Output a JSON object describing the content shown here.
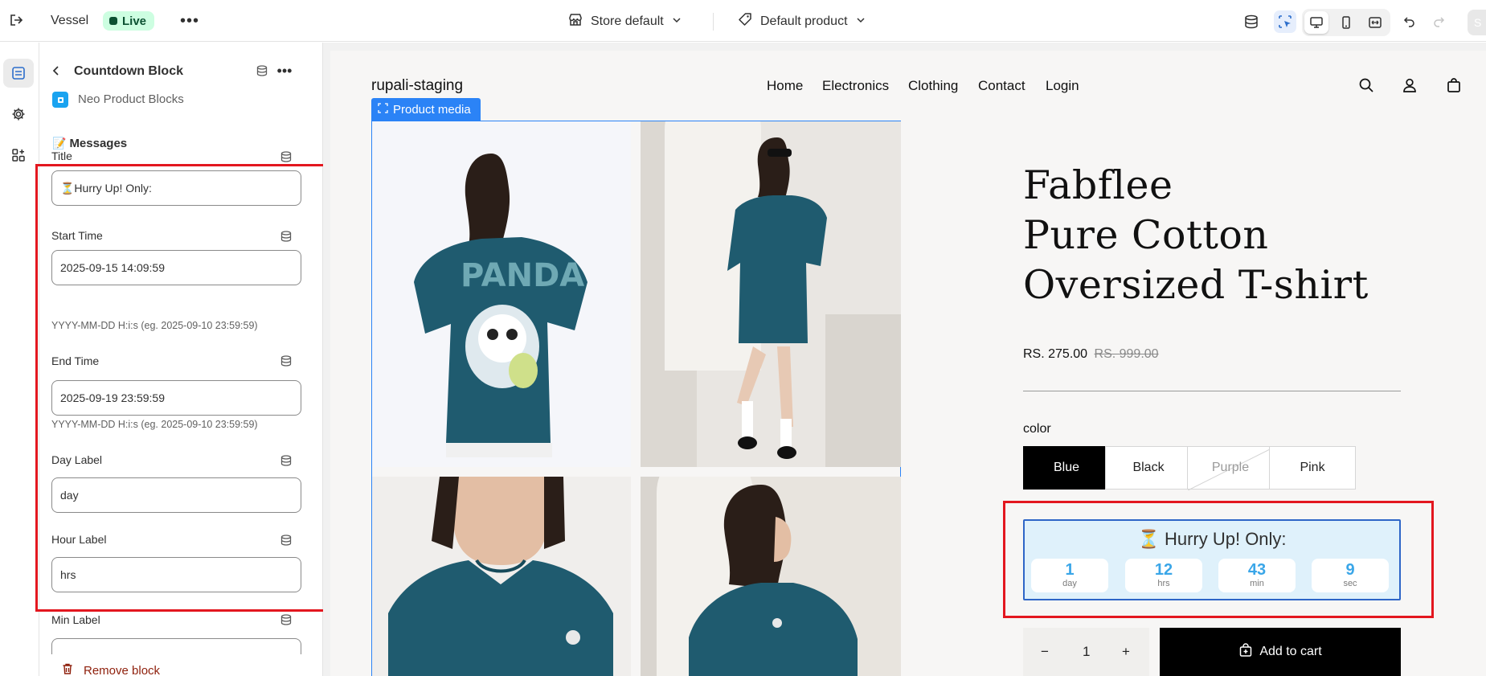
{
  "topbar": {
    "app_name": "Vessel",
    "status": "Live",
    "more": "•••",
    "store_selector": "Store default",
    "product_selector": "Default product",
    "save_label": "S"
  },
  "panel": {
    "block_title": "Countdown Block",
    "app_name": "Neo Product Blocks",
    "section_title": "Messages",
    "section_emoji": "📝",
    "fields": [
      {
        "label": "Title",
        "value": "⏳Hurry Up! Only:",
        "help": ""
      },
      {
        "label": "Start Time",
        "value": "2025-09-15 14:09:59",
        "help": "YYYY-MM-DD H:i:s (eg. 2025-09-10 23:59:59)"
      },
      {
        "label": "End Time",
        "value": "2025-09-19 23:59:59",
        "help": "YYYY-MM-DD H:i:s (eg. 2025-09-10 23:59:59)"
      },
      {
        "label": "Day Label",
        "value": "day",
        "help": ""
      },
      {
        "label": "Hour Label",
        "value": "hrs",
        "help": ""
      },
      {
        "label": "Min Label",
        "value": "",
        "help": ""
      }
    ],
    "remove_label": "Remove block"
  },
  "store": {
    "logo": "rupali-staging",
    "nav": [
      "Home",
      "Electronics",
      "Clothing",
      "Contact",
      "Login"
    ],
    "media_tag": "Product media",
    "product_title_lines": [
      "Fabflee",
      "Pure Cotton",
      "Oversized T-shirt"
    ],
    "price": "RS. 275.00",
    "compare_price": "RS. 999.00",
    "option_label": "color",
    "colors": [
      "Blue",
      "Black",
      "Purple",
      "Pink"
    ],
    "selected_color": "Blue",
    "countdown": {
      "title": "⏳ Hurry Up! Only:",
      "cells": [
        {
          "value": "1",
          "unit": "day"
        },
        {
          "value": "12",
          "unit": "hrs"
        },
        {
          "value": "43",
          "unit": "min"
        },
        {
          "value": "9",
          "unit": "sec"
        }
      ]
    },
    "quantity": "1",
    "qty_minus": "−",
    "qty_plus": "+",
    "add_to_cart": "Add to cart"
  },
  "colors": {
    "highlight_red": "#e3171f",
    "live_bg": "#cdfee1",
    "selection_blue": "#2b83f6",
    "countdown_bg": "#dff1fb",
    "countdown_number": "#3aa6e8",
    "shirt_teal": "#1f5b6f"
  },
  "icons": {
    "exit": "exit-icon",
    "store": "store-icon",
    "tag": "tag-icon",
    "database": "database-icon",
    "inspector": "select-inspect-icon",
    "desktop": "desktop-icon",
    "mobile": "mobile-icon",
    "fullwidth": "fullwidth-icon",
    "undo": "undo-icon",
    "redo": "redo-icon",
    "search": "search-icon",
    "account": "account-icon",
    "cart": "cart-icon",
    "trash": "trash-icon"
  }
}
